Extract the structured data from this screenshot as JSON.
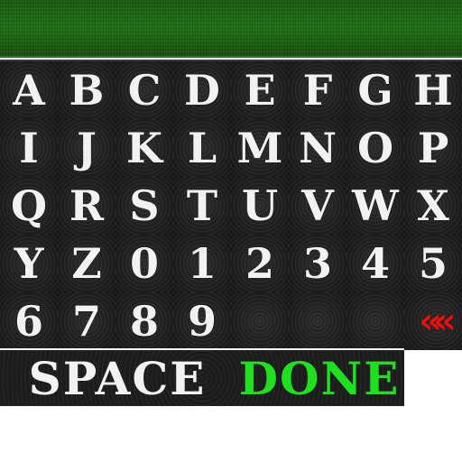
{
  "display": {
    "text": ""
  },
  "keys": [
    "A",
    "B",
    "C",
    "D",
    "E",
    "F",
    "G",
    "H",
    "I",
    "J",
    "K",
    "L",
    "M",
    "N",
    "O",
    "P",
    "Q",
    "R",
    "S",
    "T",
    "U",
    "V",
    "W",
    "X",
    "Y",
    "Z",
    "0",
    "1",
    "2",
    "3",
    "4",
    "5",
    "6",
    "7",
    "8",
    "9"
  ],
  "backspace": {
    "label": "«",
    "icon": "backspace-chevrons-icon",
    "color": "#e01414"
  },
  "actions": {
    "space_label": "SPACE",
    "done_label": "DONE",
    "space_color": "#f2f2f2",
    "done_color": "#1fe01f"
  },
  "colors": {
    "display_bg": "#207016",
    "keyboard_bg": "#1b1b1b",
    "key_text": "#f2f2f2"
  }
}
